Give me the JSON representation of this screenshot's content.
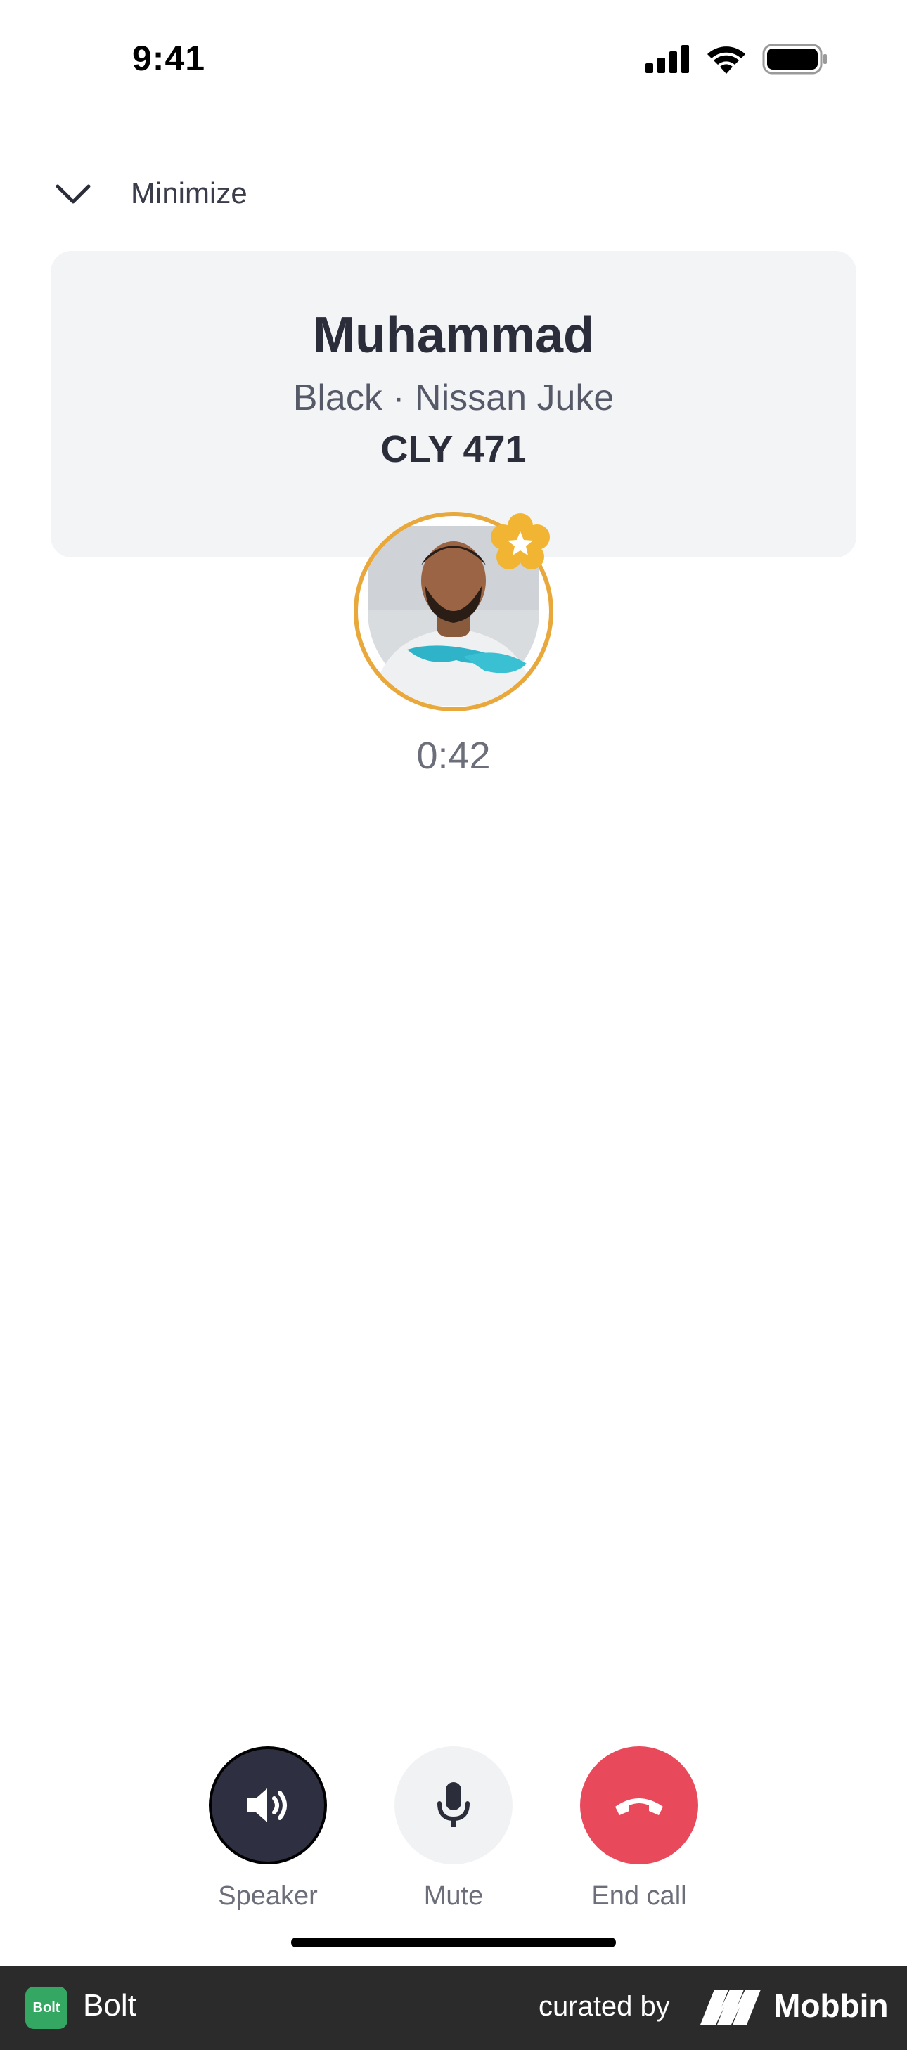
{
  "status_bar": {
    "time": "9:41"
  },
  "header": {
    "minimize_label": "Minimize"
  },
  "driver": {
    "name": "Muhammad",
    "car": "Black · Nissan Juke",
    "plate": "CLY 471"
  },
  "call": {
    "duration": "0:42",
    "controls": {
      "speaker": "Speaker",
      "mute": "Mute",
      "end": "End call"
    }
  },
  "footer": {
    "app_logo_text": "Bolt",
    "app_name": "Bolt",
    "curated_by": "curated by",
    "brand": "Mobbin"
  },
  "colors": {
    "end_call": "#e84a5c",
    "speaker_active": "#2e2f40",
    "avatar_ring": "#e8a83c",
    "bolt_green": "#34a862"
  },
  "icons": [
    "cellular-icon",
    "wifi-icon",
    "battery-icon",
    "chevron-down-icon",
    "star-badge-icon",
    "speaker-icon",
    "microphone-icon",
    "hang-up-icon"
  ]
}
